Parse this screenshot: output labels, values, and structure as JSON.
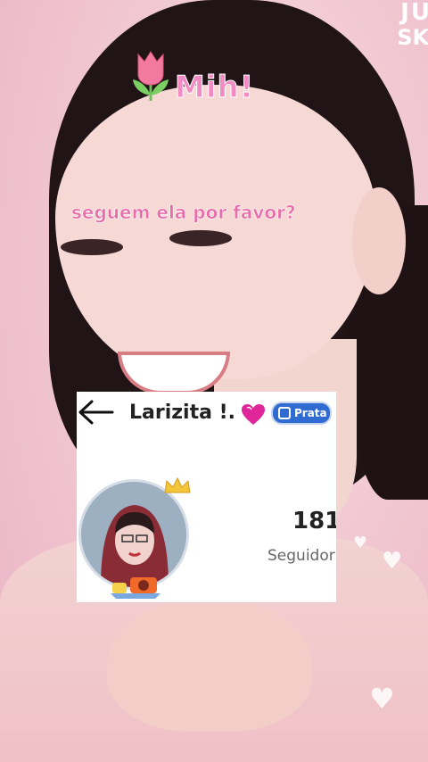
{
  "overlay": {
    "corner_line1": "JU",
    "corner_line2": "SKI",
    "title": "Mih!",
    "caption": "seguem ela por favor?"
  },
  "profile_card": {
    "username": "Larizita !.",
    "level_badge": "Prata",
    "followers_count": "181",
    "followers_label": "Seguidor"
  },
  "colors": {
    "title_pink": "#f28ac3",
    "caption_pink": "#e86ca8",
    "badge_blue": "#2f6bd0",
    "heart_magenta": "#e0279a"
  }
}
